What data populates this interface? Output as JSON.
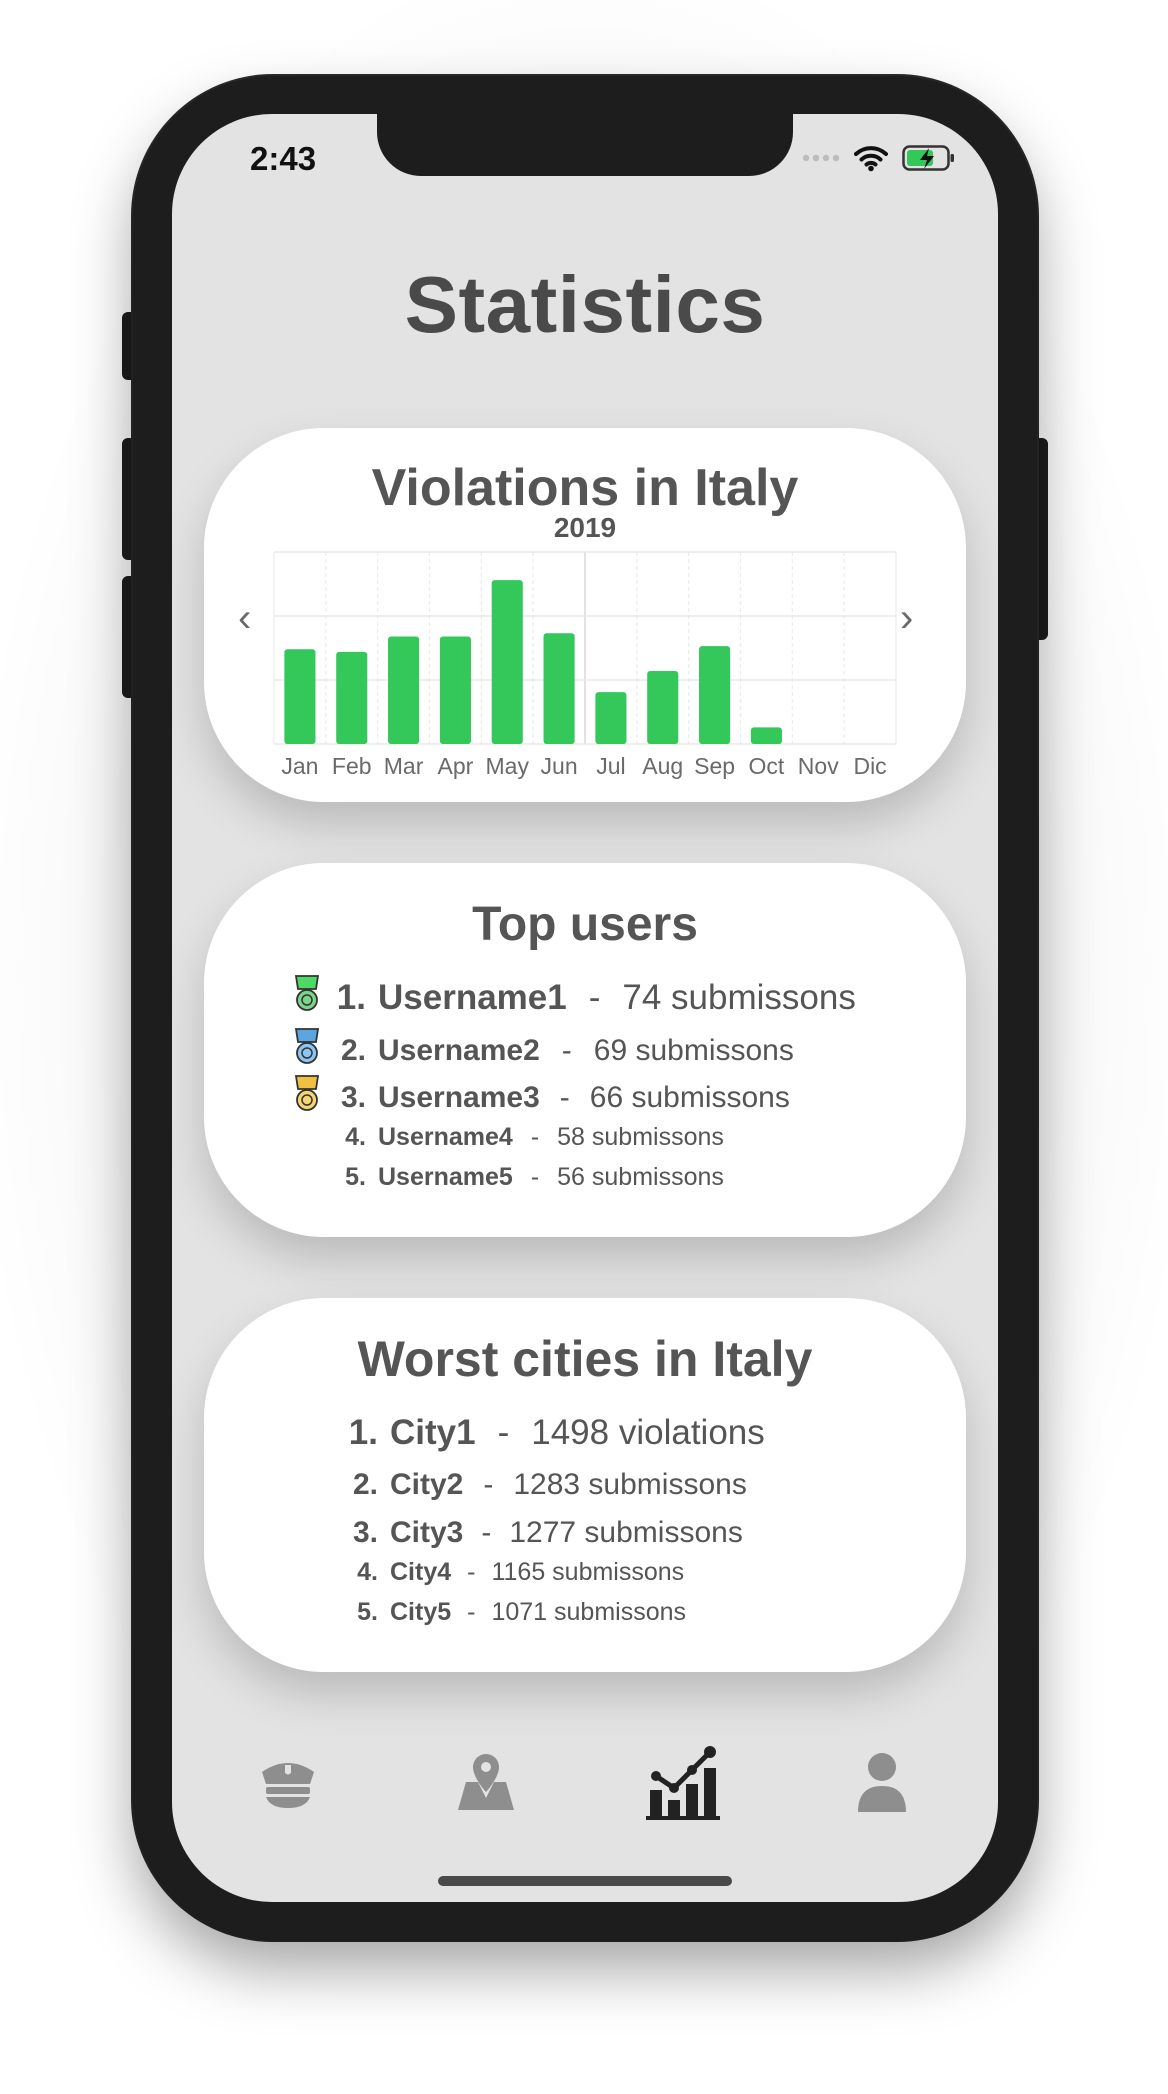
{
  "status_bar": {
    "time": "2:43"
  },
  "page": {
    "title": "Statistics"
  },
  "chart_card": {
    "title": "Violations in Italy",
    "year": "2019",
    "prev_label": "‹",
    "next_label": "›"
  },
  "chart_data": {
    "type": "bar",
    "title": "Violations in Italy",
    "subtitle": "2019",
    "categories": [
      "Jan",
      "Feb",
      "Mar",
      "Apr",
      "May",
      "Jun",
      "Jul",
      "Aug",
      "Sep",
      "Oct",
      "Nov",
      "Dic"
    ],
    "values": [
      148,
      144,
      168,
      168,
      256,
      173,
      81,
      114,
      153,
      26,
      0,
      0
    ],
    "ylim": [
      0,
      300
    ],
    "grid": true,
    "colors": {
      "bar": "#34c759"
    }
  },
  "top_users": {
    "title": "Top users",
    "rows": [
      {
        "rank": "1.",
        "name": "Username1",
        "sep": "-",
        "value": "74 submissons",
        "medal": "green-medal-icon"
      },
      {
        "rank": "2.",
        "name": "Username2",
        "sep": "-",
        "value": "69 submissons",
        "medal": "blue-medal-icon"
      },
      {
        "rank": "3.",
        "name": "Username3",
        "sep": "-",
        "value": "66 submissons",
        "medal": "gold-medal-icon"
      },
      {
        "rank": "4.",
        "name": "Username4",
        "sep": "-",
        "value": "58 submissons"
      },
      {
        "rank": "5.",
        "name": "Username5",
        "sep": "-",
        "value": "56 submissons"
      }
    ]
  },
  "worst_cities": {
    "title": "Worst cities in Italy",
    "rows": [
      {
        "rank": "1.",
        "name": "City1",
        "sep": "-",
        "value": "1498 violations"
      },
      {
        "rank": "2.",
        "name": "City2",
        "sep": "-",
        "value": "1283 submissons"
      },
      {
        "rank": "3.",
        "name": "City3",
        "sep": "-",
        "value": "1277 submissons"
      },
      {
        "rank": "4.",
        "name": "City4",
        "sep": "-",
        "value": "1165 submissons"
      },
      {
        "rank": "5.",
        "name": "City5",
        "sep": "-",
        "value": "1071 submissons"
      }
    ]
  },
  "tab_bar": {
    "items": [
      {
        "icon": "police-cap-icon"
      },
      {
        "icon": "map-pin-icon"
      },
      {
        "icon": "stats-chart-icon",
        "active": true
      },
      {
        "icon": "user-profile-icon"
      }
    ]
  },
  "colors": {
    "accent_bar": "#34c759",
    "card": "#ffffff",
    "screen_bg": "#e3e3e3",
    "text": "#555555"
  }
}
